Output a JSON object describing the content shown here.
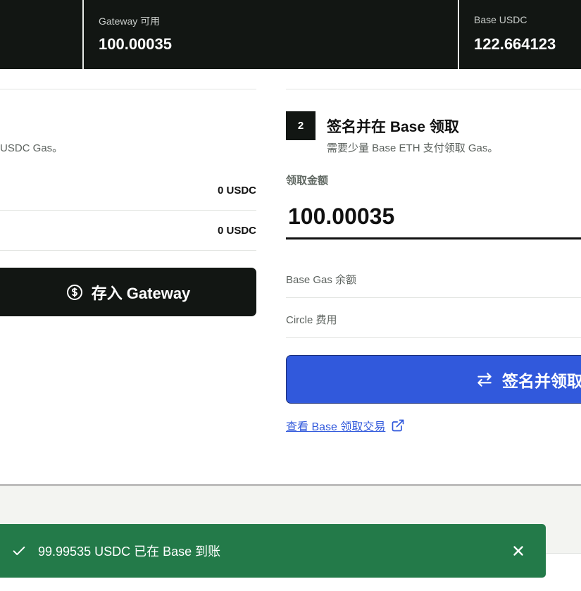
{
  "stats": [
    {
      "label": "Gateway 可用",
      "value": "100.00035"
    },
    {
      "label": "Base USDC",
      "value": "122.664123"
    }
  ],
  "left_panel": {
    "description": "USDC Gas。",
    "rows": [
      {
        "value": "0 USDC"
      },
      {
        "value": "0 USDC"
      }
    ],
    "deposit_button": {
      "label": "存入 Gateway",
      "icon": "dollar-circle-icon"
    }
  },
  "right_panel": {
    "step_number": "2",
    "title": "签名并在 Base 领取",
    "subtitle": "需要少量 Base ETH 支付领取 Gas。",
    "amount_label": "领取金额",
    "amount_value": "100.00035",
    "info_rows": [
      {
        "label": "Base Gas 余额"
      },
      {
        "label": "Circle 费用"
      }
    ],
    "claim_button": {
      "label": "签名并领取",
      "icon": "swap-arrows-icon"
    },
    "tx_link": {
      "label": "查看 Base 领取交易",
      "icon": "external-link-icon"
    }
  },
  "toast": {
    "message": "99.99535 USDC 已在 Base 到账",
    "icon": "check-icon",
    "close_icon": "close-icon",
    "color": "#237a49"
  },
  "colors": {
    "topbar": "#121613",
    "primary_button": "#3159dc",
    "dark_button": "#121613"
  }
}
